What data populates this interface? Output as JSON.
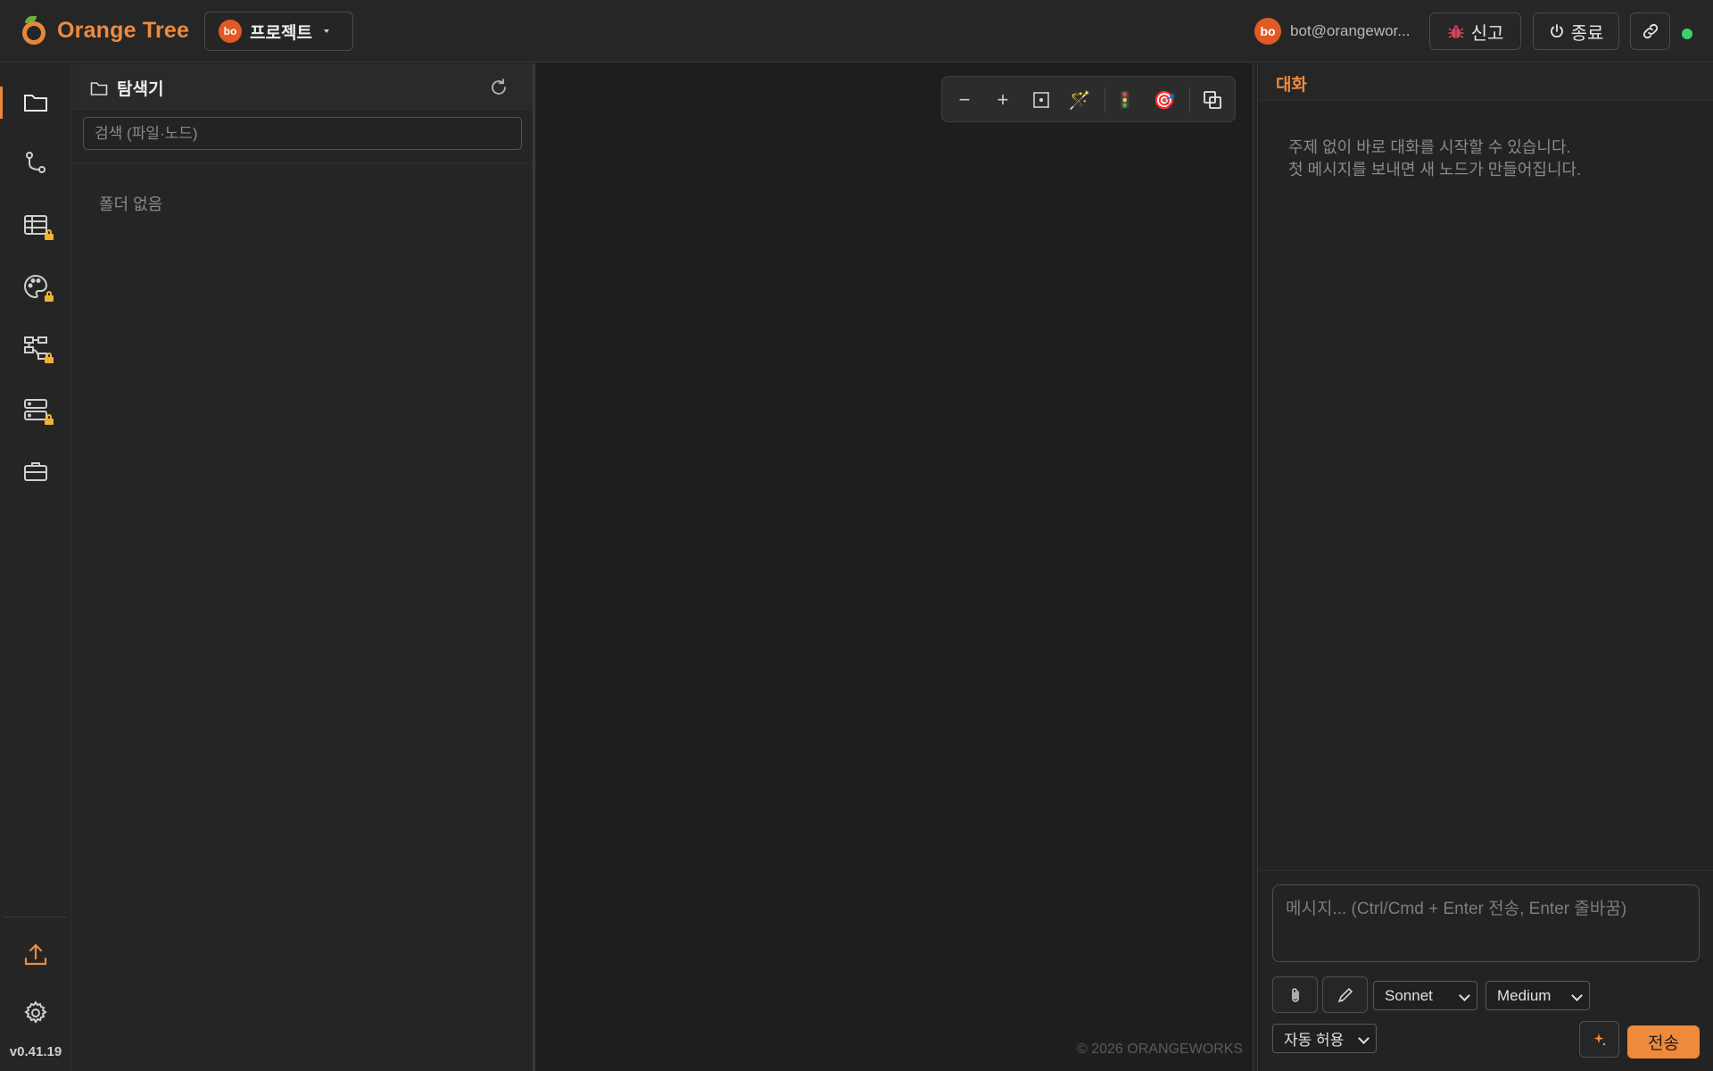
{
  "app": {
    "name": "Orange Tree"
  },
  "header": {
    "project": {
      "avatar": "bo",
      "label": "프로젝트"
    },
    "user": {
      "avatar": "bo",
      "email": "bot@orangewor..."
    },
    "report_label": "신고",
    "exit_label": "종료"
  },
  "rail": {
    "items": [
      {
        "icon": "folder-icon",
        "locked": false
      },
      {
        "icon": "git-branch-icon",
        "locked": false
      },
      {
        "icon": "table-icon",
        "locked": true
      },
      {
        "icon": "palette-icon",
        "locked": true
      },
      {
        "icon": "hierarchy-icon",
        "locked": true
      },
      {
        "icon": "server-icon",
        "locked": true
      },
      {
        "icon": "briefcase-icon",
        "locked": false
      },
      {
        "icon": "upload-icon",
        "locked": false
      },
      {
        "icon": "gear-icon",
        "locked": false
      }
    ],
    "version": "v0.41.19"
  },
  "explorer": {
    "title": "탐색기",
    "search_placeholder": "검색 (파일·노드)",
    "empty_text": "폴더 없음"
  },
  "canvas": {
    "toolbar": [
      {
        "icon": "zoom-out-icon",
        "glyph": "−"
      },
      {
        "icon": "zoom-in-icon",
        "glyph": "+"
      },
      {
        "icon": "fit-view-icon",
        "glyph": ""
      },
      {
        "icon": "magic-wand-icon",
        "glyph": "🪄"
      },
      {
        "icon": "traffic-light-icon",
        "glyph": "🚦"
      },
      {
        "icon": "target-icon",
        "glyph": "🎯"
      },
      {
        "icon": "overlap-icon",
        "glyph": ""
      }
    ],
    "copyright": "© 2026 ORANGEWORKS"
  },
  "chat": {
    "title": "대화",
    "hint_line1": "주제 없이 바로 대화를 시작할 수 있습니다.",
    "hint_line2": "첫 메시지를 보내면 새 노드가 만들어집니다.",
    "input_placeholder": "메시지... (Ctrl/Cmd + Enter 전송, Enter 줄바꿈)",
    "model": "Sonnet",
    "effort": "Medium",
    "permission": "자동 허용",
    "send_label": "전송"
  },
  "colors": {
    "accent": "#ee8a3f",
    "avatar": "#e05a26",
    "status_online": "#3ecf6a",
    "lock": "#f0b232"
  }
}
